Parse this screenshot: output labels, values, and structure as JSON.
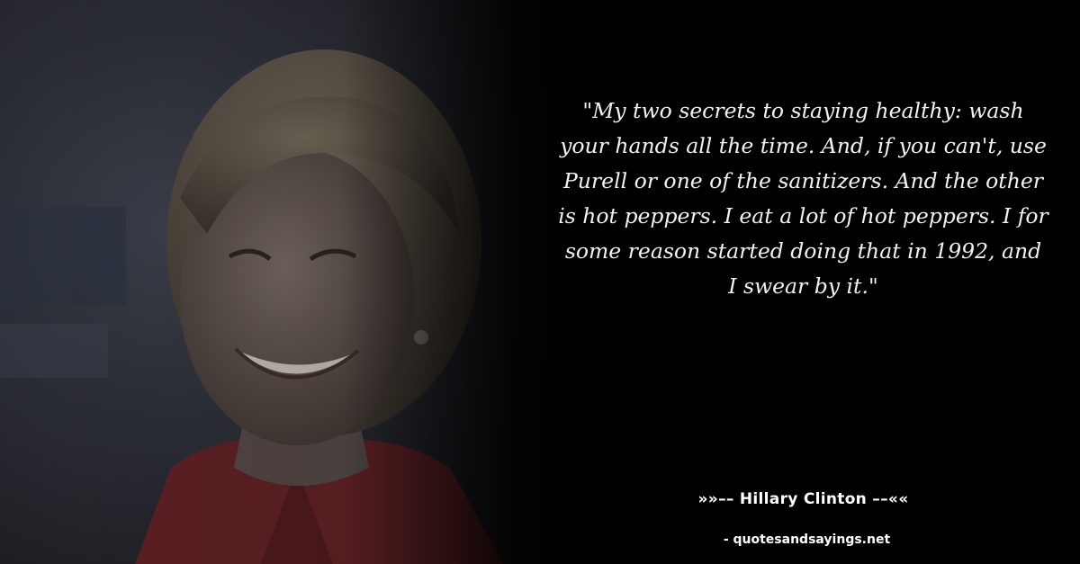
{
  "quote": {
    "text": "\"My two secrets to staying healthy: wash your hands all the time. And, if you can't, use Purell or one of the sanitizers. And the other is hot peppers. I eat a lot of hot peppers. I for some reason started doing that in 1992, and I swear by it.\""
  },
  "author": {
    "line": "»»–– Hillary Clinton ––««"
  },
  "source": {
    "text": "- quotesandsayings.net"
  },
  "colors": {
    "background": "#000000",
    "text": "#f2f2f2",
    "jacket": "#5a1f22"
  }
}
